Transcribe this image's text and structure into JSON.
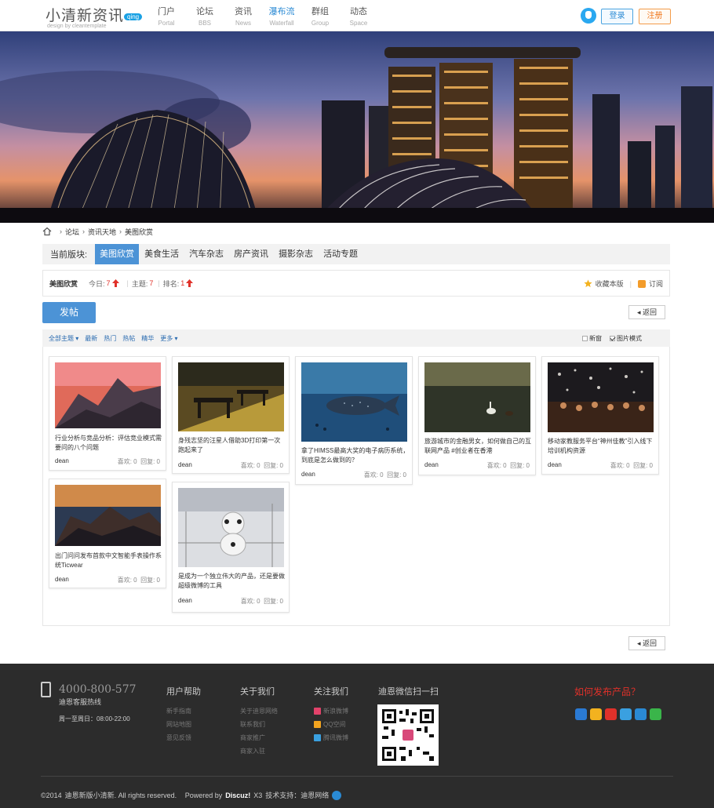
{
  "header": {
    "logo_text": "小清新资讯",
    "logo_badge": "qing",
    "logo_sub": "design by cleantemplate",
    "nav": [
      {
        "label": "门户",
        "en": "Portal",
        "active": false
      },
      {
        "label": "论坛",
        "en": "BBS",
        "active": false
      },
      {
        "label": "资讯",
        "en": "News",
        "active": false
      },
      {
        "label": "瀑布流",
        "en": "Waterfall",
        "active": true
      },
      {
        "label": "群组",
        "en": "Group",
        "active": false
      },
      {
        "label": "动态",
        "en": "Space",
        "active": false
      }
    ],
    "login": "登录",
    "register": "注册"
  },
  "breadcrumb": [
    "论坛",
    "资讯天地",
    "美图欣赏"
  ],
  "forum_tabs": {
    "label": "当前版块:",
    "tabs": [
      "美图欣赏",
      "美食生活",
      "汽车杂志",
      "房产资讯",
      "摄影杂志",
      "活动专题"
    ],
    "active": "美图欣赏"
  },
  "info": {
    "name": "美图欣赏",
    "today_label": "今日:",
    "today": "7",
    "topics_label": "主题:",
    "topics": "7",
    "rank_label": "排名:",
    "rank": "1",
    "favorite": "收藏本版",
    "subscribe": "订阅"
  },
  "post_button": "发帖",
  "back": "返回",
  "filter": {
    "items": [
      "全部主题",
      "最新",
      "热门",
      "热帖",
      "精华",
      "更多"
    ],
    "new_window": "新窗",
    "pic_mode": "图片模式"
  },
  "cards": [
    {
      "title": "行业分析与竞品分析：评估竞业模式需要问的八个问题",
      "author": "dean",
      "likes": "喜欢: 0",
      "replies": "回复: 0"
    },
    {
      "title": "身残志坚的汪星人借助3D打印第一次跑起来了",
      "author": "dean",
      "likes": "喜欢: 0",
      "replies": "回复: 0"
    },
    {
      "title": "拿了HIMSS最高大奖的电子病历系统，到底是怎么做到的？",
      "author": "dean",
      "likes": "喜欢: 0",
      "replies": "回复: 0"
    },
    {
      "title": "旅游城市的金融男女，如何做自己的互联网产品 #创业者在香港",
      "author": "dean",
      "likes": "喜欢: 0",
      "replies": "回复: 0"
    },
    {
      "title": "移动家教服务平台“神州佳教”引入线下培训机构资源",
      "author": "dean",
      "likes": "喜欢: 0",
      "replies": "回复: 0"
    },
    {
      "title": "出门问问发布首款中文智能手表操作系统Ticwear",
      "author": "dean",
      "likes": "喜欢: 0",
      "replies": "回复: 0"
    },
    {
      "title": "是成为一个独立伟大的产品，还是要做超级微博的工具",
      "author": "dean",
      "likes": "喜欢: 0",
      "replies": "回复: 0"
    }
  ],
  "footer": {
    "phone": "4000-800-577",
    "phone_label": "迪恩客服热线",
    "hours": "周一至周日：08:00-22:00",
    "help": {
      "title": "用户帮助",
      "links": [
        "新手指南",
        "网站地图",
        "意见反馈"
      ]
    },
    "about": {
      "title": "关于我们",
      "links": [
        "关于迪恩网络",
        "联系我们",
        "商家推广",
        "商家入驻"
      ]
    },
    "follow": {
      "title": "关注我们",
      "links": [
        "新浪微博",
        "QQ空间",
        "腾讯微博"
      ]
    },
    "wechat": "迪恩微信扫一扫",
    "publish": "如何发布产品？",
    "copyright_a": "©2014",
    "copyright_b": "迪恩新版小清新. All rights reserved.",
    "powered_a": "Powered by",
    "powered_b": "Discuz!",
    "powered_c": "X3",
    "support": "技术支持：迪恩网络"
  }
}
